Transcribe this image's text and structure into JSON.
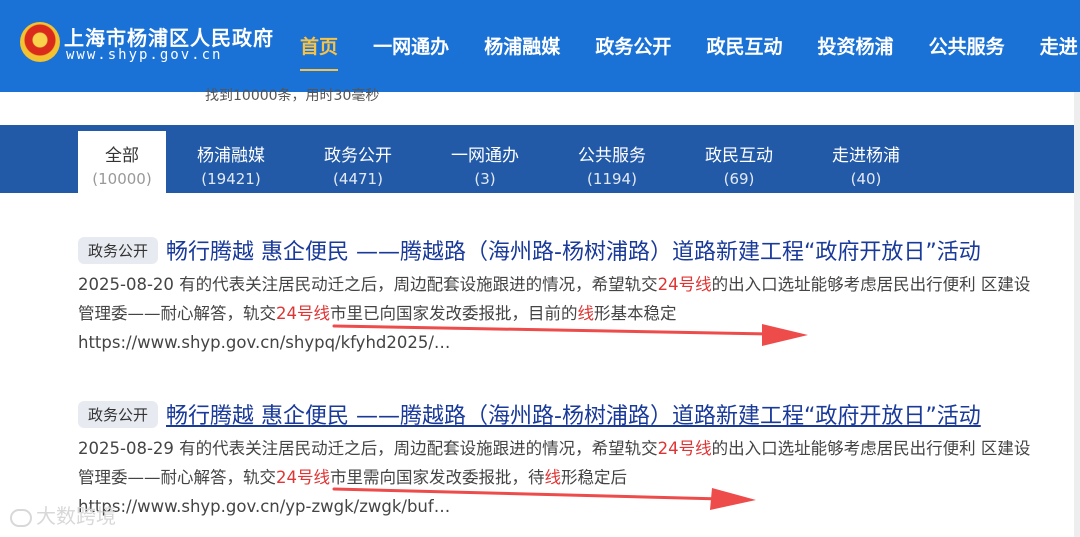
{
  "header": {
    "site_name": "上海市杨浦区人民政府",
    "site_url": "www.shyp.gov.cn",
    "nav": [
      "首页",
      "一网通办",
      "杨浦融媒",
      "政务公开",
      "政民互动",
      "投资杨浦",
      "公共服务",
      "走进"
    ],
    "active_index": 0,
    "colors": {
      "bar": "#1a71d6",
      "active": "#f5c24a"
    }
  },
  "result_count_text": "找到10000条，用时30毫秒",
  "categories": [
    {
      "label": "全部",
      "count": "(10000)"
    },
    {
      "label": "杨浦融媒",
      "count": "(19421)"
    },
    {
      "label": "政务公开",
      "count": "(4471)"
    },
    {
      "label": "一网通办",
      "count": "(3)"
    },
    {
      "label": "公共服务",
      "count": "(1194)"
    },
    {
      "label": "政民互动",
      "count": "(69)"
    },
    {
      "label": "走进杨浦",
      "count": "(40)"
    }
  ],
  "results": [
    {
      "tag": "政务公开",
      "title": "畅行腾越 惠企便民 ——腾越路（海州路-杨树浦路）道路新建工程“政府开放日”活动",
      "date": "2025-08-20",
      "snippet_parts": [
        {
          "t": " 有的代表关注居民动迁之后，周边配套设施跟进的情况，希望轨交",
          "hl": false
        },
        {
          "t": "24号线",
          "hl": true
        },
        {
          "t": "的出入口选址能够考虑居民出行便利 区建设管理委——耐心解答，轨交",
          "hl": false
        },
        {
          "t": "24号线",
          "hl": true
        },
        {
          "t": "市里已向国家发改委报批，目前的",
          "hl": false
        },
        {
          "t": "线",
          "hl": true
        },
        {
          "t": "形基本稳定",
          "hl": false
        }
      ],
      "url": "https://www.shyp.gov.cn/shypq/kfyhd2025/…"
    },
    {
      "tag": "政务公开",
      "title": "畅行腾越 惠企便民 ——腾越路（海州路-杨树浦路）道路新建工程“政府开放日”活动",
      "date": "2025-08-29",
      "snippet_parts": [
        {
          "t": " 有的代表关注居民动迁之后，周边配套设施跟进的情况，希望轨交",
          "hl": false
        },
        {
          "t": "24号线",
          "hl": true
        },
        {
          "t": "的出入口选址能够考虑居民出行便利 区建设管理委——耐心解答，轨交",
          "hl": false
        },
        {
          "t": "24号线",
          "hl": true
        },
        {
          "t": "市里需向国家发改委报批，待",
          "hl": false
        },
        {
          "t": "线",
          "hl": true
        },
        {
          "t": "形稳定后",
          "hl": false
        }
      ],
      "url": "https://www.shyp.gov.cn/yp-zwgk/zwgk/buf…"
    }
  ],
  "highlight_color": "#e03434",
  "watermark": "大数跨境"
}
